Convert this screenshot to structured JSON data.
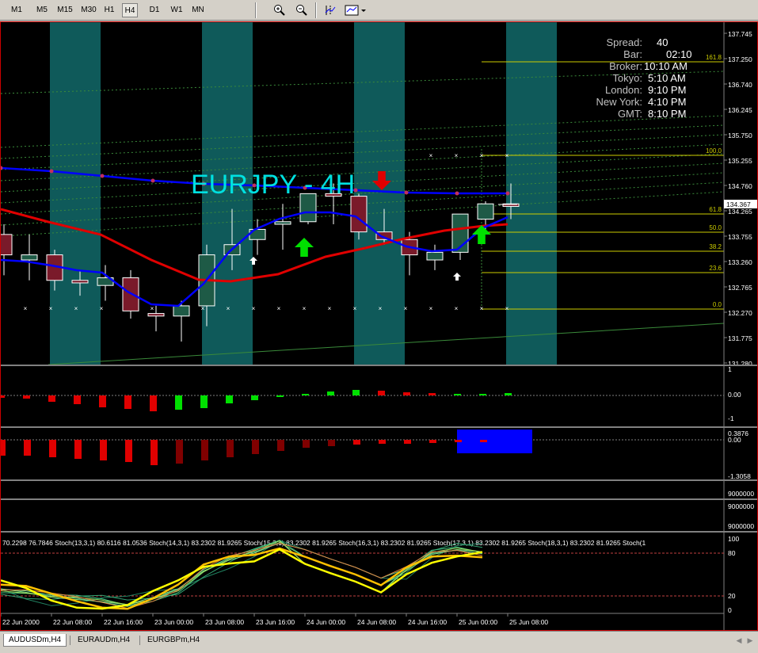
{
  "toolbar": {
    "timeframes": [
      "M1",
      "M5",
      "M15",
      "M30",
      "H1",
      "H4",
      "D1",
      "W1",
      "MN"
    ],
    "active_timeframe": "H4",
    "tools": [
      "zoom-in-icon",
      "zoom-out-icon",
      "period-separator-icon",
      "chart-template-icon"
    ]
  },
  "chart": {
    "title": "EURJPY - 4H",
    "price_axis": [
      "137.745",
      "137.250",
      "136.740",
      "136.245",
      "135.750",
      "135.255",
      "134.760",
      "134.265",
      "133.755",
      "133.260",
      "132.765",
      "132.270",
      "131.775",
      "131.280"
    ],
    "current_price": "134.367",
    "time_axis": [
      "22 Jun 2000",
      "22 Jun 08:00",
      "22 Jun 16:00",
      "23 Jun 00:00",
      "23 Jun 08:00",
      "23 Jun 16:00",
      "24 Jun 00:00",
      "24 Jun 08:00",
      "24 Jun 16:00",
      "25 Jun 00:00",
      "25 Jun 08:00"
    ],
    "fibo_levels": [
      {
        "label": "161.8",
        "color": "#cccc00"
      },
      {
        "label": "100.0",
        "color": "#cccc00"
      },
      {
        "label": "61.8",
        "color": "#cccc00"
      },
      {
        "label": "50.0",
        "color": "#cccc00"
      },
      {
        "label": "38.2",
        "color": "#cccc00"
      },
      {
        "label": "23.6",
        "color": "#cccc00"
      },
      {
        "label": "0.0",
        "color": "#cccc00"
      }
    ],
    "info": {
      "spread_label": "Spread:",
      "spread_value": "40",
      "bar_label": "Bar:",
      "bar_value": "02:10",
      "broker_label": "Broker:",
      "broker_value": "10:10 AM",
      "tokyo_label": "Tokyo:",
      "tokyo_value": "5:10 AM",
      "london_label": "London:",
      "london_value": "9:10 PM",
      "newyork_label": "New York:",
      "newyork_value": "4:10 PM",
      "gmt_label": "GMT:",
      "gmt_value": "8:10 PM"
    },
    "colors": {
      "bull": "#1e5a46",
      "bear": "#7a1a2a",
      "session": "#0f5a5a",
      "ma_blue": "#0000ff",
      "ma_red": "#e00000",
      "info_text": "#c0c0c0"
    }
  },
  "indicator1": {
    "axis": [
      "1",
      "0.00",
      "-1"
    ]
  },
  "indicator2": {
    "axis": [
      "0.3876",
      "0.00",
      "-1.3058"
    ]
  },
  "indicator3": {
    "axis": [
      "9000000"
    ]
  },
  "indicator4": {
    "axis": [
      "9000000",
      "9000000"
    ]
  },
  "stoch": {
    "legend": "70.2298 76.7846   Stoch(13,3,1) 80.6116 81.0536   Stoch(14,3,1) 83.2302 81.9265   Stoch(15,3,1) 83.2302 81.9265   Stoch(16,3,1) 83.2302 81.9265   Stoch(17,3,1) 83.2302 81.9265   Stoch(18,3,1) 83.2302 81.9265   Stoch(1",
    "axis": [
      "100",
      "80",
      "20",
      "0"
    ]
  },
  "tabs": [
    "AUDUSDm,H4",
    "EURAUDm,H4",
    "EURGBPm,H4"
  ],
  "chart_data": {
    "type": "candlestick",
    "title": "EURJPY - 4H",
    "ylim": [
      131.28,
      137.745
    ],
    "candles": [
      {
        "o": 133.8,
        "h": 134.0,
        "l": 133.0,
        "c": 133.4
      },
      {
        "o": 133.3,
        "h": 133.8,
        "l": 132.9,
        "c": 133.4
      },
      {
        "o": 133.4,
        "h": 133.5,
        "l": 132.7,
        "c": 132.9
      },
      {
        "o": 132.9,
        "h": 133.1,
        "l": 132.6,
        "c": 132.85
      },
      {
        "o": 132.8,
        "h": 133.2,
        "l": 132.5,
        "c": 132.95
      },
      {
        "o": 132.95,
        "h": 133.1,
        "l": 132.15,
        "c": 132.3
      },
      {
        "o": 132.25,
        "h": 132.4,
        "l": 131.9,
        "c": 132.2
      },
      {
        "o": 132.2,
        "h": 132.5,
        "l": 131.7,
        "c": 132.4
      },
      {
        "o": 132.4,
        "h": 133.6,
        "l": 132.0,
        "c": 133.4
      },
      {
        "o": 133.4,
        "h": 134.3,
        "l": 133.1,
        "c": 133.6
      },
      {
        "o": 133.7,
        "h": 134.1,
        "l": 133.4,
        "c": 133.9
      },
      {
        "o": 134.0,
        "h": 134.4,
        "l": 133.5,
        "c": 134.05
      },
      {
        "o": 134.05,
        "h": 134.5,
        "l": 134.0,
        "c": 134.6
      },
      {
        "o": 134.6,
        "h": 134.8,
        "l": 134.0,
        "c": 134.55
      },
      {
        "o": 134.55,
        "h": 134.6,
        "l": 133.7,
        "c": 133.85
      },
      {
        "o": 133.85,
        "h": 134.3,
        "l": 133.6,
        "c": 133.7
      },
      {
        "o": 133.7,
        "h": 133.85,
        "l": 133.0,
        "c": 133.4
      },
      {
        "o": 133.3,
        "h": 133.6,
        "l": 133.1,
        "c": 133.45
      },
      {
        "o": 133.45,
        "h": 134.2,
        "l": 133.3,
        "c": 134.2
      },
      {
        "o": 134.1,
        "h": 134.45,
        "l": 133.8,
        "c": 134.4
      },
      {
        "o": 134.4,
        "h": 134.8,
        "l": 134.1,
        "c": 134.35
      }
    ],
    "blue_ma": [
      134.55,
      134.5,
      134.45,
      134.43,
      134.4,
      134.37,
      134.35,
      134.33,
      134.32,
      134.3,
      134.28,
      134.27
    ],
    "stoch_main": [
      30,
      25,
      20,
      22,
      10,
      20,
      35,
      60,
      75,
      85,
      90,
      75,
      60,
      40,
      55,
      75,
      80,
      80
    ]
  }
}
